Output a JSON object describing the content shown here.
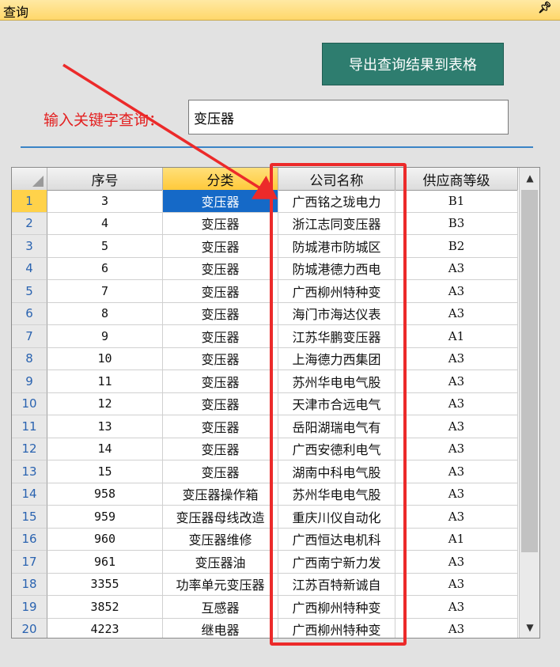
{
  "panel": {
    "title": "查询",
    "pin_icon": "pin-icon"
  },
  "toolbar": {
    "export_label": "导出查询结果到表格"
  },
  "search": {
    "label": "输入关键字查询：",
    "value": "变压器"
  },
  "table": {
    "columns": [
      "序号",
      "分类",
      "公司名称",
      "供应商等级"
    ],
    "rows": [
      {
        "rn": "1",
        "id": "3",
        "category": "变压器",
        "company": "广西铭之珑电力",
        "level": "B1"
      },
      {
        "rn": "2",
        "id": "4",
        "category": "变压器",
        "company": "浙江志同变压器",
        "level": "B3"
      },
      {
        "rn": "3",
        "id": "5",
        "category": "变压器",
        "company": "防城港市防城区",
        "level": "B2"
      },
      {
        "rn": "4",
        "id": "6",
        "category": "变压器",
        "company": "防城港德力西电",
        "level": "A3"
      },
      {
        "rn": "5",
        "id": "7",
        "category": "变压器",
        "company": "广西柳州特种变",
        "level": "A3"
      },
      {
        "rn": "6",
        "id": "8",
        "category": "变压器",
        "company": "海门市海达仪表",
        "level": "A3"
      },
      {
        "rn": "7",
        "id": "9",
        "category": "变压器",
        "company": "江苏华鹏变压器",
        "level": "A1"
      },
      {
        "rn": "8",
        "id": "10",
        "category": "变压器",
        "company": "上海德力西集团",
        "level": "A3"
      },
      {
        "rn": "9",
        "id": "11",
        "category": "变压器",
        "company": "苏州华电电气股",
        "level": "A3"
      },
      {
        "rn": "10",
        "id": "12",
        "category": "变压器",
        "company": "天津市合远电气",
        "level": "A3"
      },
      {
        "rn": "11",
        "id": "13",
        "category": "变压器",
        "company": "岳阳湖瑞电气有",
        "level": "A3"
      },
      {
        "rn": "12",
        "id": "14",
        "category": "变压器",
        "company": "广西安德利电气",
        "level": "A3"
      },
      {
        "rn": "13",
        "id": "15",
        "category": "变压器",
        "company": "湖南中科电气股",
        "level": "A3"
      },
      {
        "rn": "14",
        "id": "958",
        "category": "变压器操作箱",
        "company": "苏州华电电气股",
        "level": "A3"
      },
      {
        "rn": "15",
        "id": "959",
        "category": "变压器母线改造",
        "company": "重庆川仪自动化",
        "level": "A3"
      },
      {
        "rn": "16",
        "id": "960",
        "category": "变压器维修",
        "company": "广西恒达电机科",
        "level": "A1"
      },
      {
        "rn": "17",
        "id": "961",
        "category": "变压器油",
        "company": "广西南宁新力发",
        "level": "A3"
      },
      {
        "rn": "18",
        "id": "3355",
        "category": "功率单元变压器",
        "company": "江苏百特新诚自",
        "level": "A3"
      },
      {
        "rn": "19",
        "id": "3852",
        "category": "互感器",
        "company": "广西柳州特种变",
        "level": "A3"
      },
      {
        "rn": "20",
        "id": "4223",
        "category": "继电器",
        "company": "广西柳州特种变",
        "level": "A3"
      }
    ]
  },
  "colors": {
    "accent": "#2e7d6f",
    "label_red": "#e32020",
    "selection": "#1569c7",
    "highlight": "#ec2a2a"
  }
}
